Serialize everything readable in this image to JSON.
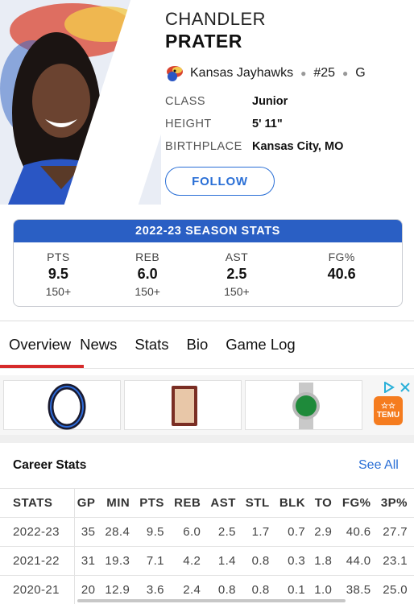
{
  "player": {
    "first_name": "CHANDLER",
    "last_name": "PRATER",
    "team": "Kansas Jayhawks",
    "number": "#25",
    "position": "G",
    "info": [
      {
        "label": "CLASS",
        "value": "Junior"
      },
      {
        "label": "HEIGHT",
        "value": "5' 11\""
      },
      {
        "label": "BIRTHPLACE",
        "value": "Kansas City, MO"
      }
    ],
    "follow_label": "FOLLOW"
  },
  "season_stats": {
    "title": "2022-23 SEASON STATS",
    "stats": [
      {
        "label": "PTS",
        "value": "9.5",
        "sub": "150+"
      },
      {
        "label": "REB",
        "value": "6.0",
        "sub": "150+"
      },
      {
        "label": "AST",
        "value": "2.5",
        "sub": "150+"
      },
      {
        "label": "FG%",
        "value": "40.6",
        "sub": ""
      }
    ]
  },
  "tabs": [
    "Overview",
    "News",
    "Stats",
    "Bio",
    "Game Log"
  ],
  "ad": {
    "temu_label_1": "☆☆",
    "temu_label_2": "TEMU"
  },
  "career": {
    "title": "Career Stats",
    "see_all": "See All",
    "headers": [
      "STATS",
      "GP",
      "MIN",
      "PTS",
      "REB",
      "AST",
      "STL",
      "BLK",
      "TO",
      "FG%",
      "3P%"
    ],
    "rows": [
      [
        "2022-23",
        "35",
        "28.4",
        "9.5",
        "6.0",
        "2.5",
        "1.7",
        "0.7",
        "2.9",
        "40.6",
        "27.7"
      ],
      [
        "2021-22",
        "31",
        "19.3",
        "7.1",
        "4.2",
        "1.4",
        "0.8",
        "0.3",
        "1.8",
        "44.0",
        "23.1"
      ],
      [
        "2020-21",
        "20",
        "12.9",
        "3.6",
        "2.4",
        "0.8",
        "0.8",
        "0.1",
        "1.0",
        "38.5",
        "25.0"
      ]
    ]
  },
  "colors": {
    "accent": "#2a5fc4",
    "link": "#2a6fd6",
    "tab_active": "#d62b2b",
    "temu": "#f57c1f"
  }
}
